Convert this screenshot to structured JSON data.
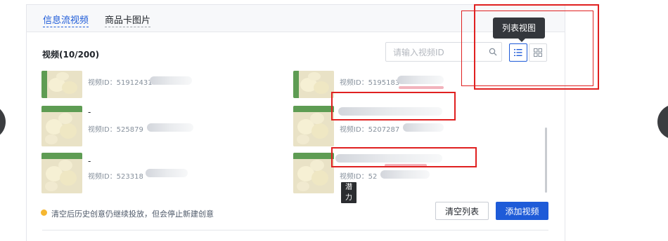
{
  "tabs": [
    {
      "label": "信息流视频",
      "active": true
    },
    {
      "label": "商品卡图片",
      "active": false
    }
  ],
  "section_title": "视频(10/200)",
  "search": {
    "placeholder": "请输入视频ID",
    "value": ""
  },
  "view_toggle": {
    "list_icon": "list-view-icon",
    "grid_icon": "grid-view-icon",
    "active": "list"
  },
  "tooltip": "列表视图",
  "videos": [
    {
      "name": "",
      "id_text": "视频ID：51912431",
      "tag": ""
    },
    {
      "name": "",
      "id_text": "视频ID：5195183",
      "tag": ""
    },
    {
      "name": "-",
      "id_text": "视频ID：525879",
      "tag": ""
    },
    {
      "name": "",
      "id_text": "视频ID：5207287",
      "tag": ""
    },
    {
      "name": "-",
      "id_text": "视频ID：523318",
      "tag": ""
    },
    {
      "name": "",
      "id_text": "视频ID：52",
      "tag": "潜力"
    }
  ],
  "hint": "清空后历史创意仍继续投放，但会停止新建创意",
  "buttons": {
    "clear": "清空列表",
    "add": "添加视频"
  },
  "colors": {
    "primary": "#1e5bd8",
    "annotation_red": "#e02020",
    "warning": "#f5b731"
  }
}
